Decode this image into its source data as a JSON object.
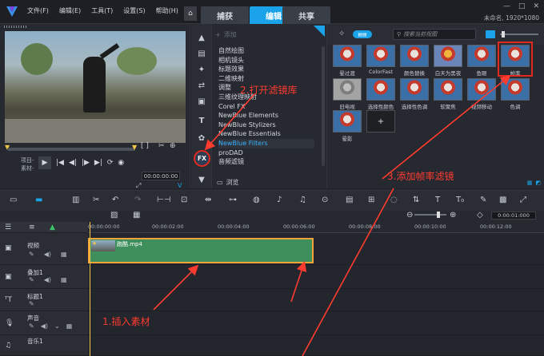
{
  "app": {
    "menu": [
      "文件(F)",
      "编辑(E)",
      "工具(T)",
      "设置(S)",
      "帮助(H)"
    ],
    "tabs": [
      {
        "label": "捕获",
        "active": false
      },
      {
        "label": "编辑",
        "active": true
      },
      {
        "label": "共享",
        "active": false
      }
    ],
    "project_info": "未命名, 1920*1080",
    "accent_color": "#1aa3e8"
  },
  "preview": {
    "mode_labels": [
      "项目-",
      "素材-"
    ],
    "timecode": "00:00:00:00",
    "v_label": "V"
  },
  "library": {
    "add_label": "添加",
    "fx_label": "FX",
    "categories": [
      {
        "label": "自然绘图",
        "selected": false
      },
      {
        "label": "相机镜头",
        "selected": false
      },
      {
        "label": "标题效果",
        "selected": false
      },
      {
        "label": "二维映射",
        "selected": false
      },
      {
        "label": "调整",
        "selected": false
      },
      {
        "label": "三维纹理映射",
        "selected": false
      },
      {
        "label": "Corel FX",
        "selected": false
      },
      {
        "label": "NewBlue Elements",
        "selected": false
      },
      {
        "label": "NewBlue Stylizers",
        "selected": false
      },
      {
        "label": "NewBlue Essentials",
        "selected": false
      },
      {
        "label": "NewBlue Filters",
        "selected": true
      },
      {
        "label": "proDAD",
        "selected": false
      },
      {
        "label": "音频滤镜",
        "selected": false
      }
    ],
    "browse_label": "浏览"
  },
  "thumbnails": {
    "search_placeholder": "搜索当前视图",
    "items": [
      {
        "label": "晕过渡",
        "style": "normal"
      },
      {
        "label": "ColorFast",
        "style": "normal"
      },
      {
        "label": "颜色替换",
        "style": "normal"
      },
      {
        "label": "白天为黑夜",
        "style": "alt1"
      },
      {
        "label": "鱼眼",
        "style": "normal"
      },
      {
        "label": "帧率",
        "style": "normal"
      },
      {
        "label": "旧电视",
        "style": "alt2"
      },
      {
        "label": "选择性颜色",
        "style": "normal"
      },
      {
        "label": "选择性色调",
        "style": "normal"
      },
      {
        "label": "软聚焦",
        "style": "normal"
      },
      {
        "label": "视频移动",
        "style": "normal"
      },
      {
        "label": "色调",
        "style": "normal"
      },
      {
        "label": "晕影",
        "style": "normal"
      },
      {
        "label": "",
        "style": "add"
      }
    ]
  },
  "timeline": {
    "ruler_ticks": [
      "00:00:00:00",
      "00:00:02:00",
      "00:00:04:00",
      "00:00:06:00",
      "00:00:08:00",
      "00:00:10:00",
      "00:00:12:00"
    ],
    "zoom_timecode": "0:00:01:000",
    "tracks": [
      "视频",
      "叠加1",
      "标题1",
      "声音",
      "音乐1"
    ],
    "clip_name": "跑酷.mp4"
  },
  "annotations": {
    "step1": "1.插入素材",
    "step2": "2.打开滤镜库",
    "step3": "3.添加帧率滤镜"
  }
}
